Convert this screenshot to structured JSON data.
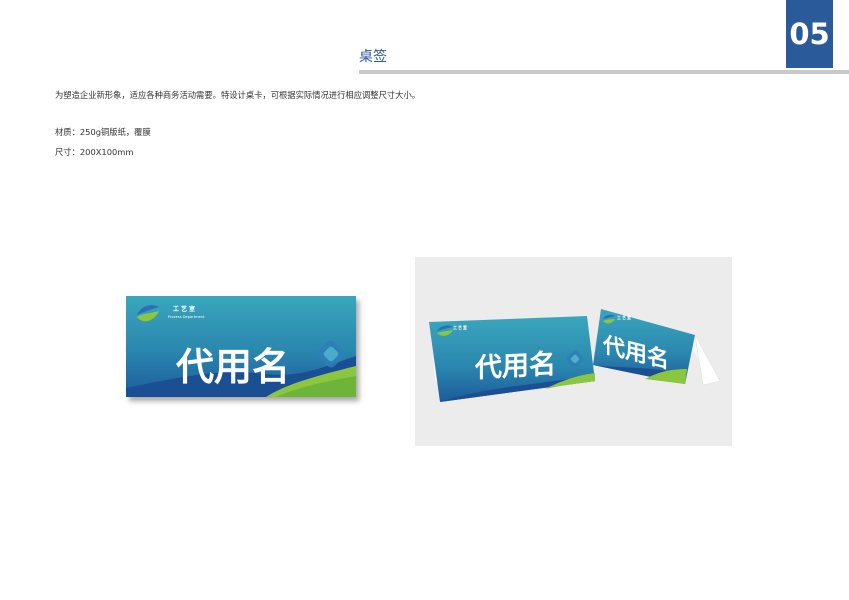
{
  "header": {
    "page_number": "05",
    "section_title": "桌签"
  },
  "body": {
    "description": "为塑造企业新形象，适应各种商务活动需要。特设计桌卡，可根据实际情况进行相应调整尺寸大小。",
    "material": "材质：250g铜版纸，覆膜",
    "size": "尺寸：200X100mm"
  },
  "card": {
    "logo_cn": "工艺室",
    "logo_en": "Process Department",
    "name_placeholder": "代用名"
  },
  "colors": {
    "brand_blue": "#2b5a9a",
    "teal": "#3aa7bd",
    "green": "#8cc63f",
    "rule_gray": "#c8c8c8"
  }
}
